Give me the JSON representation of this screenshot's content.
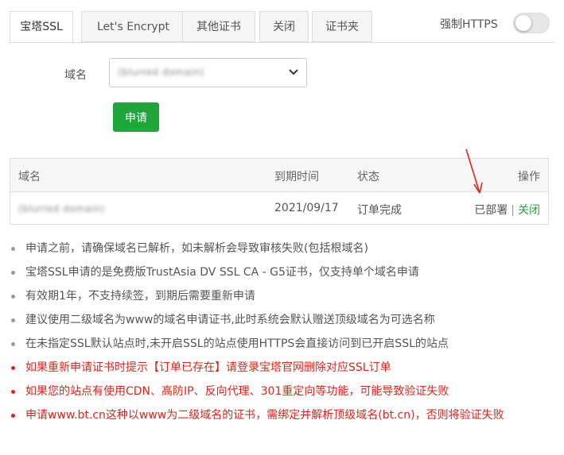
{
  "tabs": [
    {
      "label": "宝塔SSL",
      "active": true
    },
    {
      "label": "Let's Encrypt",
      "active": false
    },
    {
      "label": "其他证书",
      "active": false
    },
    {
      "label": "关闭",
      "active": false
    },
    {
      "label": "证书夹",
      "active": false
    }
  ],
  "force_https": {
    "label": "强制HTTPS",
    "enabled": false
  },
  "apply_form": {
    "domain_label": "域名",
    "selected_domain": "(blurred domain)",
    "apply_button": "申请"
  },
  "table": {
    "headers": {
      "domain": "域名",
      "expire": "到期时间",
      "status": "状态",
      "actions": "操作"
    },
    "rows": [
      {
        "domain": "(blurred domain)",
        "expire": "2021/09/17",
        "status": "订单完成",
        "deployed": "已部署",
        "separator": "|",
        "close": "关闭"
      }
    ]
  },
  "tips": [
    "申请之前，请确保域名已解析，如未解析会导致审核失败(包括根域名)",
    "宝塔SSL申请的是免费版TrustAsia DV SSL CA - G5证书，仅支持单个域名申请",
    "有效期1年，不支持续签，到期后需要重新申请",
    "建议使用二级域名为www的域名申请证书,此时系统会默认赠送顶级域名为可选名称",
    "在未指定SSL默认站点时,未开启SSL的站点使用HTTPS会直接访问到已开启SSL的站点",
    "如果重新申请证书时提示【订单已存在】请登录宝塔官网删除对应SSL订单",
    "如果您的站点有使用CDN、高防IP、反向代理、301重定向等功能，可能导致验证失败",
    "申请www.bt.cn这种以www为二级域名的证书，需绑定并解析顶级域名(bt.cn)，否则将验证失败"
  ],
  "colors": {
    "accent": "#20a53a",
    "warning": "#e0241b"
  }
}
